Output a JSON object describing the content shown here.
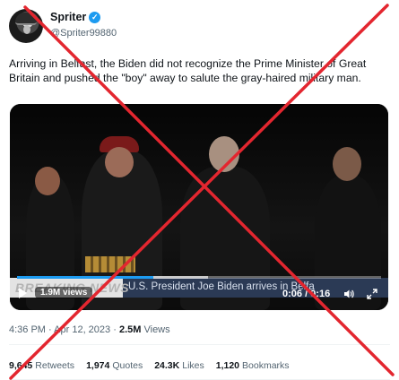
{
  "author": {
    "display_name": "Spriter",
    "handle": "@Spriter99880",
    "verified_icon": "verified-badge-icon"
  },
  "tweet": {
    "text": "Arriving in Belfast, the Biden did not recognize the Prime Minister of Great Britain and pushed the \"boy\" away to salute the gray-haired military man."
  },
  "video": {
    "breaking_label": "BREAKING NEWS",
    "headline": "U.S. President Joe Biden arrives in Belfa",
    "views": "1.9M views",
    "time": "0:06 / 0:16",
    "progress": 0.375
  },
  "meta": {
    "time": "4:36 PM",
    "separator": "·",
    "date": "Apr 12, 2023",
    "views_count": "2.5M",
    "views_label": "Views"
  },
  "stats": {
    "retweets_count": "9,645",
    "retweets_label": "Retweets",
    "quotes_count": "1,974",
    "quotes_label": "Quotes",
    "likes_count": "24.3K",
    "likes_label": "Likes",
    "bookmarks_count": "1,120",
    "bookmarks_label": "Bookmarks"
  },
  "colors": {
    "accent": "#1d9bf0",
    "cross_overlay": "#e3262f",
    "secondary_text": "#536471"
  }
}
